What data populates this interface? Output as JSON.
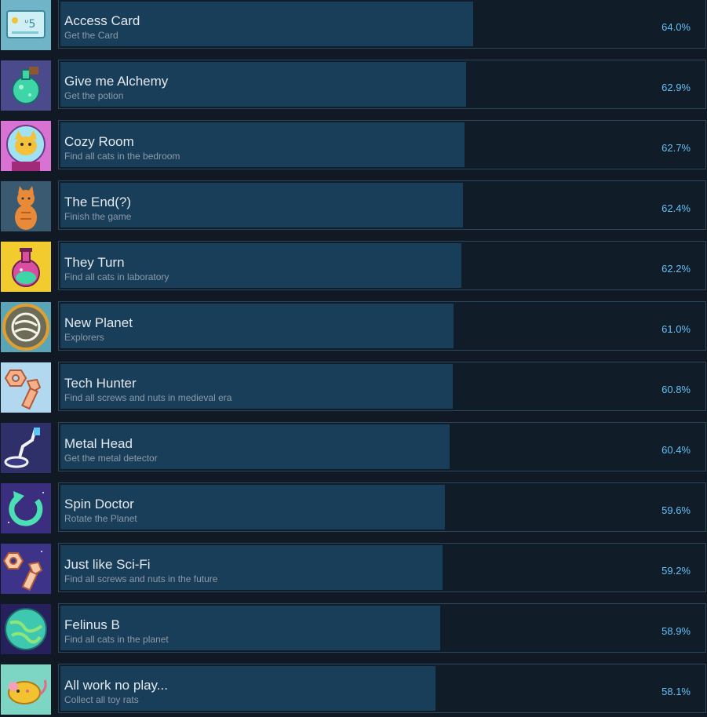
{
  "achievements": [
    {
      "title": "Access Card",
      "description": "Get the Card",
      "percent_label": "64.0%",
      "percent": 64.0,
      "icon": "access-card-icon",
      "icon_bg": "#6fb4c7"
    },
    {
      "title": "Give me Alchemy",
      "description": "Get the potion",
      "percent_label": "62.9%",
      "percent": 62.9,
      "icon": "green-potion-icon",
      "icon_bg": "#4a4a8c"
    },
    {
      "title": "Cozy Room",
      "description": "Find all cats in the bedroom",
      "percent_label": "62.7%",
      "percent": 62.7,
      "icon": "astronaut-cat-icon",
      "icon_bg": "#d873d3"
    },
    {
      "title": "The End(?)",
      "description": "Finish the game",
      "percent_label": "62.4%",
      "percent": 62.4,
      "icon": "sitting-cat-icon",
      "icon_bg": "#3a5a72"
    },
    {
      "title": "They Turn",
      "description": "Find all cats in laboratory",
      "percent_label": "62.2%",
      "percent": 62.2,
      "icon": "pink-flask-icon",
      "icon_bg": "#f2cb2e"
    },
    {
      "title": "New Planet",
      "description": "Explorers",
      "percent_label": "61.0%",
      "percent": 61.0,
      "icon": "planet-medal-icon",
      "icon_bg": "#5aa6b8"
    },
    {
      "title": "Tech Hunter",
      "description": "Find all screws and nuts in medieval era",
      "percent_label": "60.8%",
      "percent": 60.8,
      "icon": "screw-and-nut-icon",
      "icon_bg": "#b2d8ef"
    },
    {
      "title": "Metal Head",
      "description": "Get the metal detector",
      "percent_label": "60.4%",
      "percent": 60.4,
      "icon": "metal-detector-icon",
      "icon_bg": "#2f2f6a"
    },
    {
      "title": "Spin Doctor",
      "description": "Rotate the Planet",
      "percent_label": "59.6%",
      "percent": 59.6,
      "icon": "rotate-arrow-icon",
      "icon_bg": "#3b2e7e"
    },
    {
      "title": "Just like Sci-Fi",
      "description": "Find all screws and nuts in the future",
      "percent_label": "59.2%",
      "percent": 59.2,
      "icon": "space-screw-icon",
      "icon_bg": "#3d3388"
    },
    {
      "title": "Felinus B",
      "description": "Find all cats in the planet",
      "percent_label": "58.9%",
      "percent": 58.9,
      "icon": "green-planet-icon",
      "icon_bg": "#26205c"
    },
    {
      "title": "All work no play...",
      "description": "Collect all toy rats",
      "percent_label": "58.1%",
      "percent": 58.1,
      "icon": "toy-rat-icon",
      "icon_bg": "#7dd6c3"
    }
  ],
  "colors": {
    "background": "#111a24",
    "panel": "#101c28",
    "panel_border": "#2a475e",
    "progress_fill": "#193e5a",
    "title_text": "#e4e8ec",
    "description_text": "#8c9aa7",
    "percent_text": "#66c0f4"
  }
}
